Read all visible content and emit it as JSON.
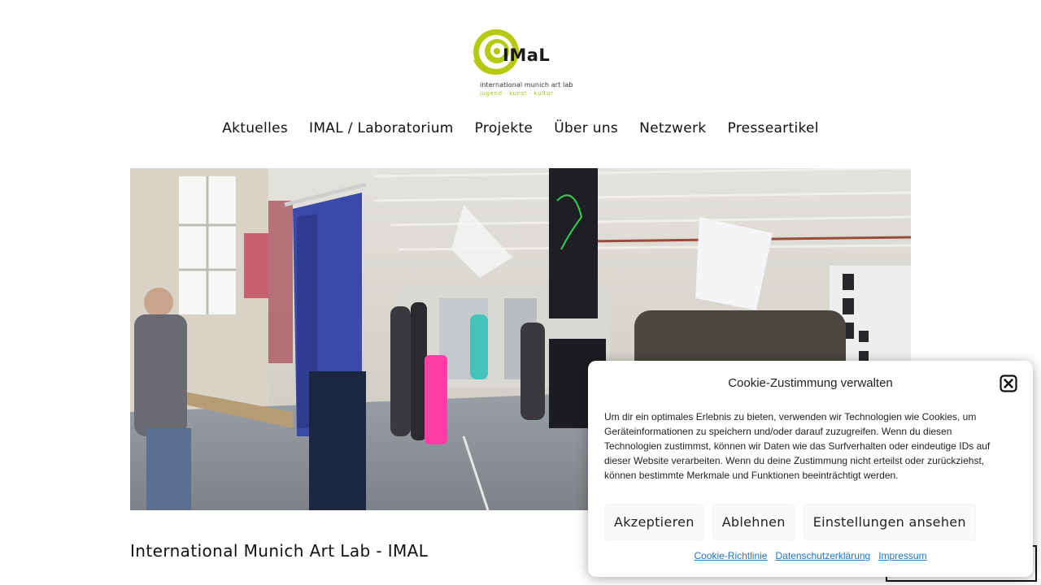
{
  "logo": {
    "wordmark": "IMaL",
    "subtitle": "international munich art lab",
    "tagline": "jugend · kunst · kultur",
    "spiral_color": "#b5c90f"
  },
  "nav": {
    "items": [
      {
        "label": "Aktuelles"
      },
      {
        "label": "IMAL / Laboratorium"
      },
      {
        "label": "Projekte"
      },
      {
        "label": "Über uns"
      },
      {
        "label": "Netzwerk"
      },
      {
        "label": "Presseartikel"
      }
    ]
  },
  "main": {
    "heading": "International Munich Art Lab - IMAL"
  },
  "cookie_banner": {
    "title": "Cookie-Zustimmung verwalten",
    "body": "Um dir ein optimales Erlebnis zu bieten, verwenden wir Technologien wie Cookies, um Geräteinformationen zu speichern und/oder darauf zuzugreifen. Wenn du diesen Technologien zustimmst, können wir Daten wie das Surfverhalten oder eindeutige IDs auf dieser Website verarbeiten. Wenn du deine Zustimmung nicht erteilst oder zurückziehst, können bestimmte Merkmale und Funktionen beeinträchtigt werden.",
    "accept_label": "Akzeptieren",
    "deny_label": "Ablehnen",
    "settings_label": "Einstellungen ansehen",
    "links": [
      {
        "label": "Cookie-Richtlinie"
      },
      {
        "label": "Datenschutzerklärung"
      },
      {
        "label": "Impressum"
      }
    ],
    "link_color": "#1e73be"
  }
}
